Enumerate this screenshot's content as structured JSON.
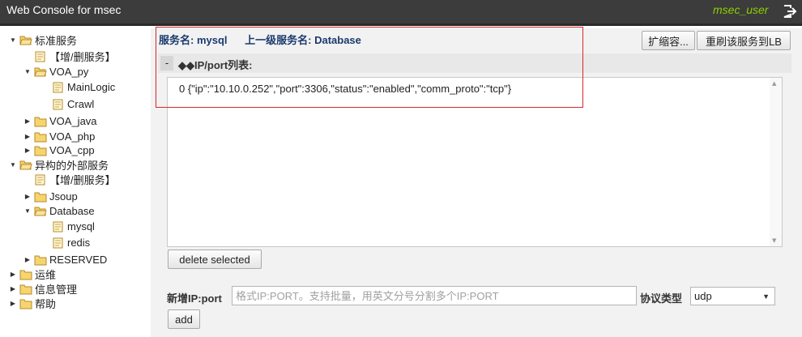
{
  "header": {
    "app_title": "Web Console for msec",
    "user": "msec_user"
  },
  "tree": [
    {
      "label": "标准服务",
      "toggle": "▼",
      "folder": "open"
    },
    {
      "label": "【增/删服务】",
      "toggle": "",
      "folder": "doc"
    },
    {
      "label": "VOA_py",
      "toggle": "▼",
      "folder": "open"
    },
    {
      "label": "MainLogic",
      "toggle": "",
      "folder": "doc"
    },
    {
      "label": "Crawl",
      "toggle": "",
      "folder": "doc"
    },
    {
      "label": "VOA_java",
      "toggle": "▶",
      "folder": "closed"
    },
    {
      "label": "VOA_php",
      "toggle": "▶",
      "folder": "closed"
    },
    {
      "label": "VOA_cpp",
      "toggle": "▶",
      "folder": "closed"
    },
    {
      "label": "异构的外部服务",
      "toggle": "▼",
      "folder": "open"
    },
    {
      "label": "【增/删服务】",
      "toggle": "",
      "folder": "doc"
    },
    {
      "label": "Jsoup",
      "toggle": "▶",
      "folder": "closed"
    },
    {
      "label": "Database",
      "toggle": "▼",
      "folder": "open"
    },
    {
      "label": "mysql",
      "toggle": "",
      "folder": "doc"
    },
    {
      "label": "redis",
      "toggle": "",
      "folder": "doc"
    },
    {
      "label": "RESERVED",
      "toggle": "▶",
      "folder": "closed"
    },
    {
      "label": "运维",
      "toggle": "▶",
      "folder": "closed"
    },
    {
      "label": "信息管理",
      "toggle": "▶",
      "folder": "closed"
    },
    {
      "label": "帮助",
      "toggle": "▶",
      "folder": "closed"
    }
  ],
  "service": {
    "name_label": "服务名: mysql",
    "parent_label": "上一级服务名: Database"
  },
  "buttons": {
    "expand": "扩缩容...",
    "refresh": "重刷该服务到LB",
    "delete": "delete selected",
    "add": "add"
  },
  "panel": {
    "collapse": "-",
    "title": "◆◆IP/port列表:"
  },
  "ip_list": [
    "0 {\"ip\":\"10.10.0.252\",\"port\":3306,\"status\":\"enabled\",\"comm_proto\":\"tcp\"}"
  ],
  "form": {
    "new_ip_label": "新增IP:port",
    "ip_placeholder": "格式IP:PORT。支持批量，用英文分号分割多个IP:PORT",
    "proto_label": "协议类型",
    "proto_value": "udp"
  },
  "colors": {
    "topbar": "#3c3c3c",
    "user": "#8fce00",
    "highlight": "#d9262b",
    "service_text": "#1a3a6e"
  }
}
